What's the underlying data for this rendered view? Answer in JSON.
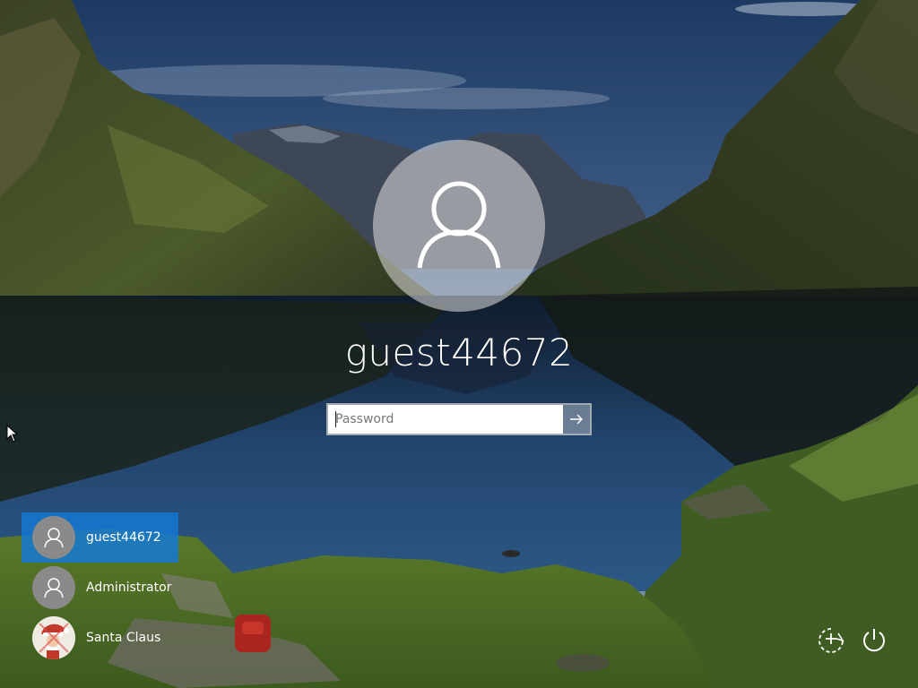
{
  "login": {
    "current_user": "guest44672",
    "password_placeholder": "Password",
    "password_value": ""
  },
  "users": [
    {
      "name": "guest44672",
      "selected": true,
      "avatar": "default-user-icon"
    },
    {
      "name": "Administrator",
      "selected": false,
      "avatar": "default-user-icon"
    },
    {
      "name": "Santa Claus",
      "selected": false,
      "avatar": "santa-claus-picture"
    }
  ],
  "system_buttons": {
    "ease_of_access_icon": "ease-of-access-icon",
    "power_icon": "power-icon"
  },
  "colors": {
    "selected_user_bg": "#1478d2",
    "avatar_gray": "#8a8a8a"
  }
}
